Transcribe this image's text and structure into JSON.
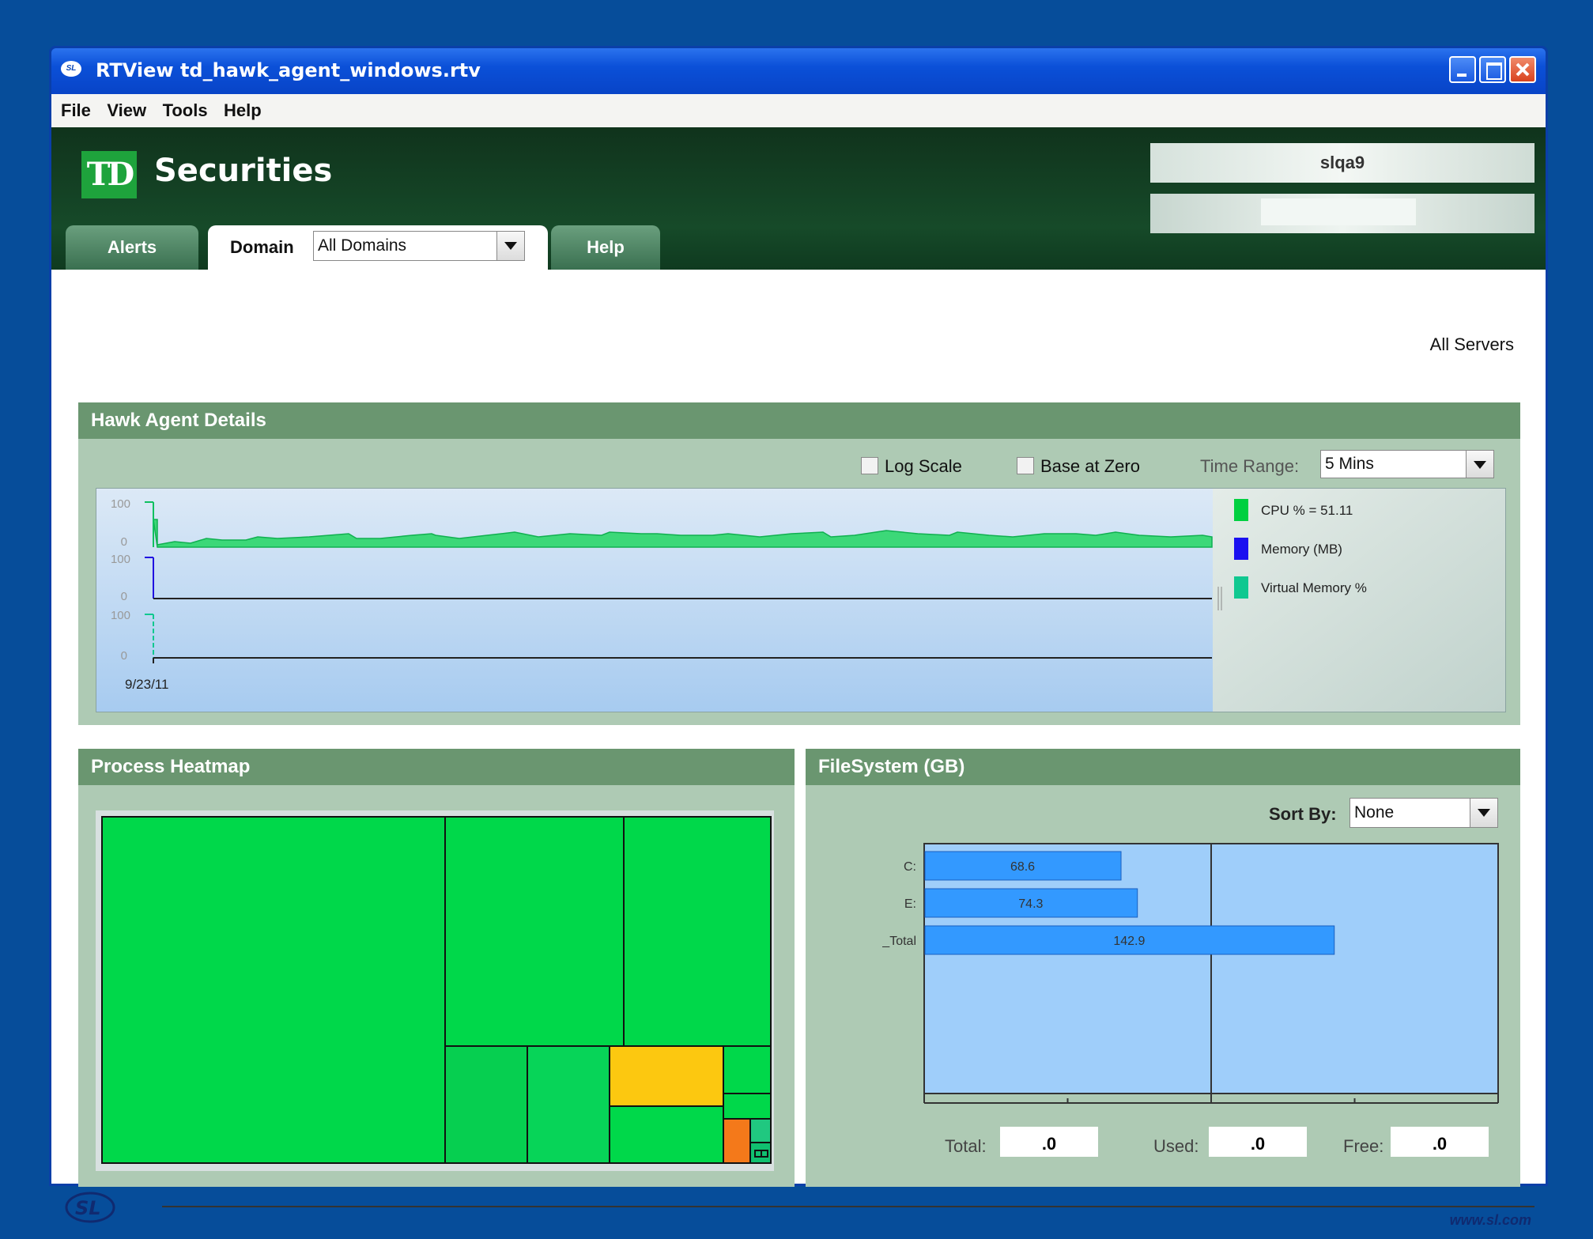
{
  "window": {
    "title": "RTView td_hawk_agent_windows.rtv"
  },
  "menu": [
    "File",
    "View",
    "Tools",
    "Help"
  ],
  "brand": {
    "logo": "TD",
    "name": "Securities"
  },
  "user": {
    "name": "slqa9"
  },
  "tabs": {
    "alerts": "Alerts",
    "domain": "Domain",
    "help": "Help"
  },
  "domain_select": {
    "value": "All Domains"
  },
  "nav": {
    "all_servers": "All Servers"
  },
  "hawk": {
    "title": "Hawk Agent Details",
    "log_scale": "Log Scale",
    "base_at_zero": "Base at Zero",
    "time_range_label": "Time Range:",
    "time_range_value": "5 Mins",
    "start_date": "9/23/11",
    "tick_top": "100",
    "tick_bottom": "0",
    "legend": [
      {
        "label": "CPU % = 51.11",
        "color": "#00d040"
      },
      {
        "label": "Memory (MB)",
        "color": "#1a10f0"
      },
      {
        "label": "Virtual Memory %",
        "color": "#10c890"
      }
    ]
  },
  "heatmap": {
    "title": "Process Heatmap"
  },
  "filesystem": {
    "title": "FileSystem (GB)",
    "sort_label": "Sort By:",
    "sort_value": "None",
    "total_label": "Total:",
    "total_value": ".0",
    "used_label": "Used:",
    "used_value": ".0",
    "free_label": "Free:",
    "free_value": ".0"
  },
  "chart_data": {
    "type": "bar",
    "orientation": "horizontal",
    "categories": [
      "C:",
      "E:",
      "_Total"
    ],
    "values": [
      68.6,
      74.3,
      142.9
    ],
    "xlim": [
      0,
      200
    ],
    "xticks": [
      0,
      100,
      200
    ],
    "color": "#3399ff"
  },
  "footer": {
    "url": "www.sl.com",
    "logo": "SL"
  }
}
